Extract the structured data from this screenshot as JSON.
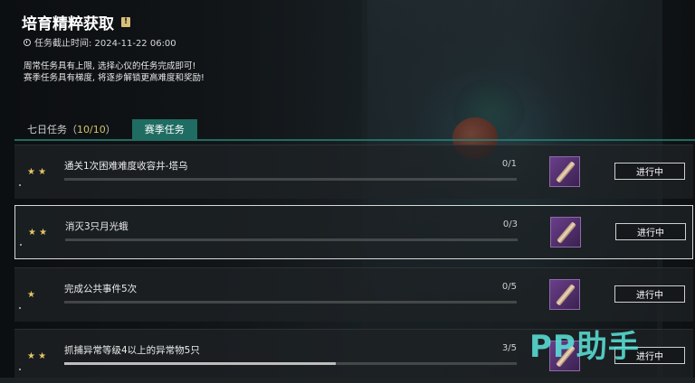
{
  "header": {
    "title": "培育精粹获取",
    "deadline": "任务截止时间: 2024-11-22 06:00",
    "desc_line1": "周常任务具有上限, 选择心仪的任务完成即可!",
    "desc_line2": "赛季任务具有梯度, 将逐步解锁更高难度和奖励!"
  },
  "tabs": {
    "weekly_label": "七日任务（",
    "weekly_count": "10/10",
    "weekly_close": "）",
    "season_label": "赛季任务"
  },
  "tasks": [
    {
      "name": "通关1次困难难度收容井-塔乌",
      "progress": "0/1",
      "fraction": 0,
      "stars": "★ ★",
      "status": "进行中"
    },
    {
      "name": "消灭3只月光蛾",
      "progress": "0/3",
      "fraction": 0,
      "stars": "★ ★",
      "status": "进行中"
    },
    {
      "name": "完成公共事件5次",
      "progress": "0/5",
      "fraction": 0,
      "stars": "★",
      "status": "进行中"
    },
    {
      "name": "抓捕异常等级4以上的异常物5只",
      "progress": "3/5",
      "fraction": 0.6,
      "stars": "★ ★",
      "status": "进行中"
    }
  ],
  "watermark": "PP助手",
  "colors": {
    "accent": "#1f6c62",
    "star": "#e3c564",
    "watermark": "#5ae6dc"
  }
}
